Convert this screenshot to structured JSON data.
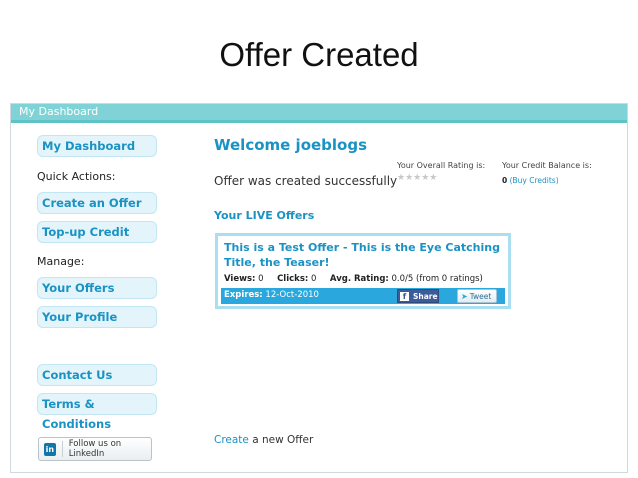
{
  "slide": {
    "title": "Offer Created"
  },
  "app": {
    "header": "My Dashboard"
  },
  "sidebar": {
    "my_dashboard": "My Dashboard",
    "quick_actions": "Quick Actions:",
    "create_offer": "Create an Offer",
    "topup": "Top-up Credit",
    "manage": "Manage:",
    "your_offers": "Your Offers",
    "your_profile": "Your Profile",
    "contact": "Contact Us",
    "terms": "Terms & Conditions",
    "linkedin": "Follow us on LinkedIn",
    "linkedin_logo": "in"
  },
  "main": {
    "welcome": "Welcome joeblogs",
    "message": "Offer was created successfully",
    "rating_label": "Your Overall Rating is:",
    "stars": "★★★★★",
    "credit_label": "Your Credit Balance is:",
    "credit_value": "0",
    "buy_credits": "(Buy Credits)",
    "live_offers_heading": "Your LIVE Offers",
    "offer": {
      "title": "This is a Test Offer - This is the Eye Catching Title, the Teaser!",
      "views_label": "Views:",
      "views": "0",
      "clicks_label": "Clicks:",
      "clicks": "0",
      "rating_label": "Avg. Rating:",
      "rating": "0.0/5 (from 0 ratings)",
      "expires_label": "Expires:",
      "expires": "12-Oct-2010",
      "share": "Share",
      "tweet": "Tweet"
    },
    "create_link": "Create",
    "create_rest": " a new Offer"
  },
  "colors": {
    "accent": "#1a92c4",
    "header_bar": "#7fd3d6",
    "footer_bar": "#2aa8de"
  }
}
